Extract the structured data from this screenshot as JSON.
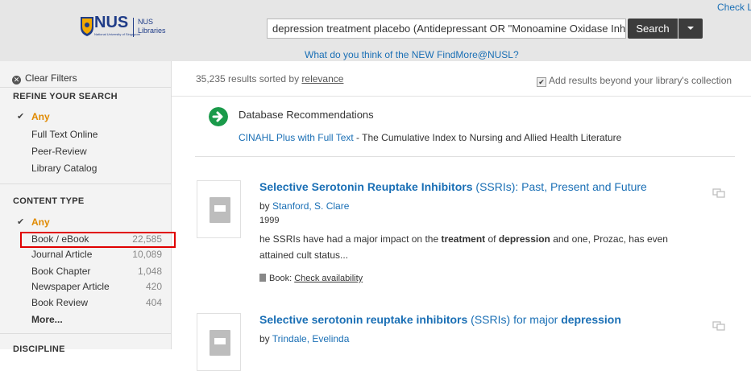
{
  "header": {
    "logo": {
      "name": "NUS",
      "subtitle": "National University of Singapore",
      "library": [
        "NUS",
        "Libraries"
      ]
    },
    "check_link": "Check L",
    "search": {
      "query": "depression treatment placebo (Antidepressant OR \"Monoamine Oxidase Inh",
      "button": "Search"
    },
    "feedback_link": "What do you think of the NEW FindMore@NUSL?"
  },
  "sidebar": {
    "clear_filters": "Clear Filters",
    "refine": {
      "title": "REFINE YOUR SEARCH",
      "items": [
        "Any",
        "Full Text Online",
        "Peer-Review",
        "Library Catalog"
      ]
    },
    "content_type": {
      "title": "CONTENT TYPE",
      "any": "Any",
      "items": [
        {
          "label": "Book / eBook",
          "count": "22,585"
        },
        {
          "label": "Journal Article",
          "count": "10,089"
        },
        {
          "label": "Book Chapter",
          "count": "1,048"
        },
        {
          "label": "Newspaper Article",
          "count": "420"
        },
        {
          "label": "Book Review",
          "count": "404"
        }
      ],
      "more": "More..."
    },
    "next_section": "DISCIPLINE"
  },
  "main": {
    "results_count": "35,235 results sorted by",
    "sort": "relevance",
    "add_beyond": "Add results beyond your library's collection",
    "db_recs": {
      "title": "Database Recommendations",
      "link": "CINAHL Plus with Full Text",
      "desc": " - The Cumulative Index to Nursing and Allied Health Literature"
    },
    "results": [
      {
        "title_bold": "Selective Serotonin Reuptake Inhibitors",
        "title_rest": " (SSRIs): Past, Present and Future",
        "by": "by ",
        "author": "Stanford, S. Clare",
        "year": "1999",
        "snip1": "he SSRIs have had a major impact on the ",
        "snip_b1": "treatment",
        "snip2": " of ",
        "snip_b2": "depression",
        "snip3": " and one, Prozac, has even",
        "snip4": "attained cult status...",
        "avail_type": "Book: ",
        "avail_link": "Check availability"
      },
      {
        "title_bold": "Selective serotonin reuptake inhibitors",
        "title_mid": " (SSRIs) for major ",
        "title_bold2": "depression",
        "by": "by ",
        "author": "Trindale, Evelinda"
      }
    ]
  },
  "colors": {
    "accent_link": "#1a6fb5",
    "any_active": "#e08a00",
    "highlight_box": "#e00000",
    "db_icon": "#1a9a4a"
  }
}
